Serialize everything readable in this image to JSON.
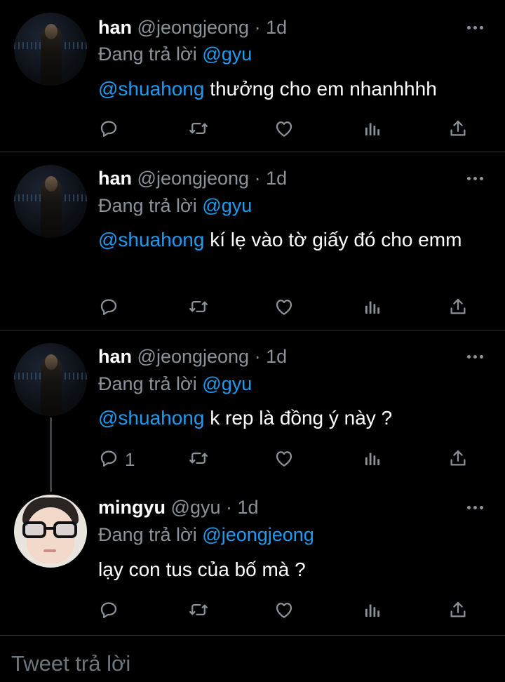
{
  "tweets": [
    {
      "name": "han",
      "handle": "@jeongjeong",
      "separator": "·",
      "time": "1d",
      "reply_prefix": "Đang trả lời",
      "reply_to": "@gyu",
      "mention": "@shuahong",
      "text": " thưởng cho em nhanhhhh",
      "reply_count": ""
    },
    {
      "name": "han",
      "handle": "@jeongjeong",
      "separator": "·",
      "time": "1d",
      "reply_prefix": "Đang trả lời",
      "reply_to": "@gyu",
      "mention": "@shuahong",
      "text": " kí lẹ vào tờ giấy đó cho emm",
      "reply_count": ""
    },
    {
      "name": "han",
      "handle": "@jeongjeong",
      "separator": "·",
      "time": "1d",
      "reply_prefix": "Đang trả lời",
      "reply_to": "@gyu",
      "mention": "@shuahong",
      "text": " k rep là đồng ý này ?",
      "reply_count": "1"
    },
    {
      "name": "mingyu",
      "handle": "@gyu",
      "separator": "·",
      "time": "1d",
      "reply_prefix": "Đang trả lời",
      "reply_to": "@jeongjeong",
      "mention": "",
      "text": "lạy con tus của bố mà ?",
      "reply_count": ""
    }
  ],
  "icons": {
    "reply": "reply-icon",
    "retweet": "retweet-icon",
    "like": "heart-icon",
    "analytics": "analytics-icon",
    "share": "share-icon",
    "more": "more-icon"
  },
  "composer": {
    "placeholder": "Tweet trả lời"
  },
  "colors": {
    "background": "#000000",
    "accent": "#1d9bf0",
    "secondary_text": "#8b9299",
    "divider": "#2f3336"
  }
}
